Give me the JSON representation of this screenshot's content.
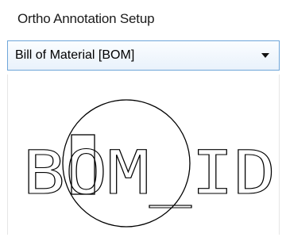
{
  "panel": {
    "title": "Ortho Annotation Setup"
  },
  "dropdown": {
    "selected": "Bill of Material [BOM]"
  },
  "preview": {
    "symbol": "BOM_ID"
  }
}
